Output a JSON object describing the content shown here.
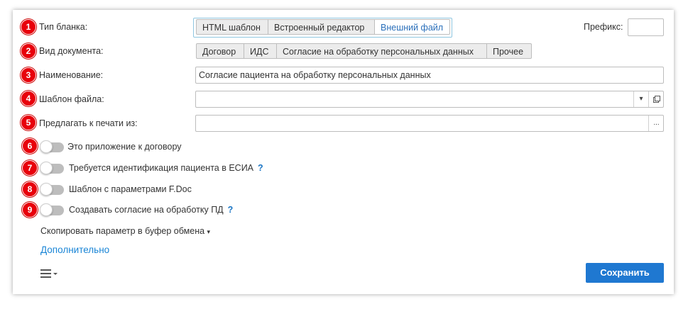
{
  "rows": [
    {
      "num": "1",
      "label": "Тип бланка:"
    },
    {
      "num": "2",
      "label": "Вид документа:"
    },
    {
      "num": "3",
      "label": "Наименование:"
    },
    {
      "num": "4",
      "label": "Шаблон файла:"
    },
    {
      "num": "5",
      "label": "Предлагать к печати из:"
    }
  ],
  "form_type": {
    "options": [
      "HTML шаблон",
      "Встроенный редактор",
      "Внешний файл"
    ],
    "selected": "Внешний файл"
  },
  "prefix": {
    "label": "Префикс:",
    "value": ""
  },
  "doc_kind": {
    "options": [
      "Договор",
      "ИДС",
      "Согласие на обработку персональных данных",
      "Прочее"
    ]
  },
  "name_value": "Согласие пациента на обработку персональных данных",
  "template_file_value": "",
  "print_from_value": "",
  "toggles": [
    {
      "num": "6",
      "label": "Это приложение к договору",
      "help": ""
    },
    {
      "num": "7",
      "label": "Требуется идентификация пациента в ЕСИА",
      "help": "?"
    },
    {
      "num": "8",
      "label": "Шаблон с параметрами F.Doc",
      "help": ""
    },
    {
      "num": "9",
      "label": "Создавать согласие на обработку ПД",
      "help": "?"
    }
  ],
  "copy_param": "Скопировать параметр в буфер обмена",
  "more_link": "Дополнительно",
  "save_label": "Сохранить",
  "icons": {
    "dropdown": "chevron-down-icon",
    "open": "open-window-icon",
    "select": "ellipsis-icon",
    "menu": "hamburger-menu-icon"
  },
  "colors": {
    "badge": "#e8000b",
    "accent": "#1f78d1",
    "link": "#1a85d6"
  }
}
